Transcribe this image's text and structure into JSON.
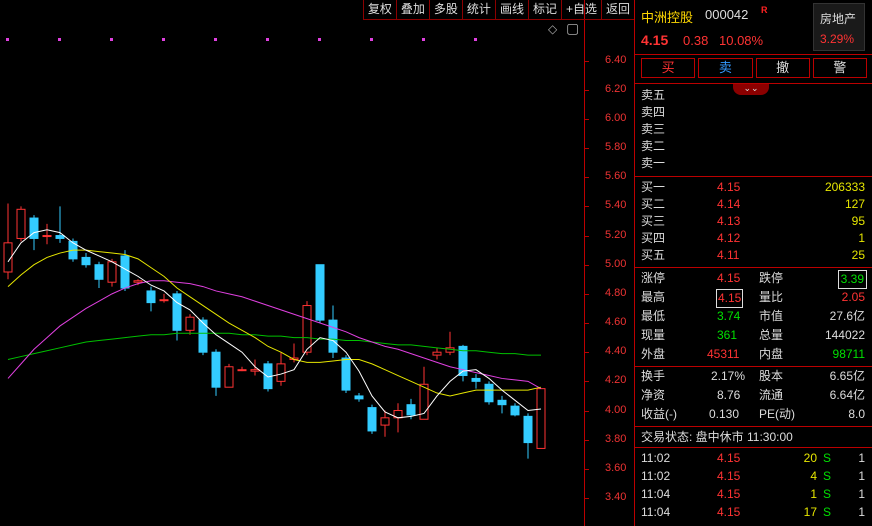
{
  "toolbar": [
    "复权",
    "叠加",
    "多股",
    "统计",
    "画线",
    "标记",
    "+自选",
    "返回"
  ],
  "chart_glyphs": {
    "diamond": "◇",
    "window": "▢"
  },
  "price_axis": [
    "6.40",
    "6.20",
    "6.00",
    "5.80",
    "5.60",
    "5.40",
    "5.20",
    "5.00",
    "4.80",
    "4.60",
    "4.40",
    "4.20",
    "4.00",
    "3.80",
    "3.60",
    "3.40"
  ],
  "chart_data": {
    "type": "candlestick",
    "ylim": [
      3.4,
      6.5
    ],
    "colors": {
      "up": "#ff3333",
      "down": "#33ccff",
      "ma5": "#ffffff",
      "ma10": "#e6e600",
      "ma20": "#e040e0",
      "ma60": "#00c000"
    },
    "candles": [
      {
        "o": 4.95,
        "h": 5.42,
        "l": 4.9,
        "c": 5.15
      },
      {
        "o": 5.18,
        "h": 5.4,
        "l": 5.16,
        "c": 5.38
      },
      {
        "o": 5.32,
        "h": 5.34,
        "l": 5.1,
        "c": 5.18
      },
      {
        "o": 5.2,
        "h": 5.28,
        "l": 5.14,
        "c": 5.2
      },
      {
        "o": 5.2,
        "h": 5.4,
        "l": 5.15,
        "c": 5.18
      },
      {
        "o": 5.16,
        "h": 5.18,
        "l": 5.02,
        "c": 5.04
      },
      {
        "o": 5.05,
        "h": 5.08,
        "l": 4.98,
        "c": 5.0
      },
      {
        "o": 5.0,
        "h": 5.02,
        "l": 4.84,
        "c": 4.9
      },
      {
        "o": 4.88,
        "h": 5.04,
        "l": 4.85,
        "c": 5.02
      },
      {
        "o": 5.06,
        "h": 5.1,
        "l": 4.82,
        "c": 4.84
      },
      {
        "o": 4.88,
        "h": 4.9,
        "l": 4.86,
        "c": 4.89
      },
      {
        "o": 4.82,
        "h": 4.85,
        "l": 4.68,
        "c": 4.74
      },
      {
        "o": 4.76,
        "h": 4.8,
        "l": 4.74,
        "c": 4.76
      },
      {
        "o": 4.8,
        "h": 4.82,
        "l": 4.48,
        "c": 4.55
      },
      {
        "o": 4.55,
        "h": 4.66,
        "l": 4.52,
        "c": 4.64
      },
      {
        "o": 4.62,
        "h": 4.64,
        "l": 4.38,
        "c": 4.4
      },
      {
        "o": 4.4,
        "h": 4.42,
        "l": 4.1,
        "c": 4.16
      },
      {
        "o": 4.16,
        "h": 4.32,
        "l": 4.16,
        "c": 4.3
      },
      {
        "o": 4.28,
        "h": 4.3,
        "l": 4.27,
        "c": 4.28
      },
      {
        "o": 4.27,
        "h": 4.35,
        "l": 4.24,
        "c": 4.28
      },
      {
        "o": 4.32,
        "h": 4.34,
        "l": 4.13,
        "c": 4.15
      },
      {
        "o": 4.2,
        "h": 4.4,
        "l": 4.17,
        "c": 4.32
      },
      {
        "o": 4.35,
        "h": 4.46,
        "l": 4.33,
        "c": 4.36
      },
      {
        "o": 4.4,
        "h": 4.75,
        "l": 4.38,
        "c": 4.72
      },
      {
        "o": 5.0,
        "h": 5.0,
        "l": 4.6,
        "c": 4.62
      },
      {
        "o": 4.62,
        "h": 4.72,
        "l": 4.36,
        "c": 4.4
      },
      {
        "o": 4.36,
        "h": 4.38,
        "l": 4.12,
        "c": 4.14
      },
      {
        "o": 4.1,
        "h": 4.12,
        "l": 4.06,
        "c": 4.08
      },
      {
        "o": 4.02,
        "h": 4.04,
        "l": 3.84,
        "c": 3.86
      },
      {
        "o": 3.9,
        "h": 4.0,
        "l": 3.82,
        "c": 3.95
      },
      {
        "o": 3.95,
        "h": 4.05,
        "l": 3.85,
        "c": 4.0
      },
      {
        "o": 4.04,
        "h": 4.08,
        "l": 3.94,
        "c": 3.97
      },
      {
        "o": 3.94,
        "h": 4.3,
        "l": 3.94,
        "c": 4.18
      },
      {
        "o": 4.38,
        "h": 4.43,
        "l": 4.35,
        "c": 4.4
      },
      {
        "o": 4.4,
        "h": 4.54,
        "l": 4.38,
        "c": 4.43
      },
      {
        "o": 4.44,
        "h": 4.45,
        "l": 4.2,
        "c": 4.24
      },
      {
        "o": 4.22,
        "h": 4.25,
        "l": 4.15,
        "c": 4.2
      },
      {
        "o": 4.18,
        "h": 4.2,
        "l": 4.04,
        "c": 4.06
      },
      {
        "o": 4.07,
        "h": 4.1,
        "l": 3.98,
        "c": 4.04
      },
      {
        "o": 4.03,
        "h": 4.05,
        "l": 3.96,
        "c": 3.97
      },
      {
        "o": 3.96,
        "h": 3.98,
        "l": 3.67,
        "c": 3.78
      },
      {
        "o": 3.74,
        "h": 4.15,
        "l": 3.74,
        "c": 4.15
      }
    ],
    "ma5": [
      5.02,
      5.15,
      5.22,
      5.24,
      5.22,
      5.15,
      5.1,
      5.06,
      5.02,
      4.97,
      4.92,
      4.86,
      4.82,
      4.74,
      4.69,
      4.6,
      4.52,
      4.46,
      4.4,
      4.3,
      4.23,
      4.25,
      4.28,
      4.42,
      4.5,
      4.48,
      4.4,
      4.27,
      4.1,
      3.99,
      3.95,
      3.96,
      3.98,
      4.1,
      4.2,
      4.27,
      4.28,
      4.22,
      4.14,
      4.07,
      4.0,
      4.01
    ],
    "ma10": [
      4.85,
      4.93,
      5.0,
      5.05,
      5.08,
      5.1,
      5.1,
      5.09,
      5.08,
      5.07,
      5.04,
      4.98,
      4.92,
      4.84,
      4.78,
      4.72,
      4.66,
      4.6,
      4.55,
      4.5,
      4.44,
      4.4,
      4.35,
      4.33,
      4.33,
      4.34,
      4.35,
      4.35,
      4.32,
      4.28,
      4.24,
      4.2,
      4.16,
      4.12,
      4.1,
      4.12,
      4.14,
      4.14,
      4.14,
      4.14,
      4.14,
      4.16
    ],
    "ma20": [
      4.22,
      4.32,
      4.42,
      4.5,
      4.58,
      4.64,
      4.7,
      4.75,
      4.8,
      4.84,
      4.87,
      4.89,
      4.89,
      4.88,
      4.87,
      4.85,
      4.82,
      4.8,
      4.78,
      4.75,
      4.72,
      4.69,
      4.66,
      4.63,
      4.6,
      4.57,
      4.54,
      4.5,
      4.47,
      4.44,
      4.42,
      4.39,
      4.36,
      4.33,
      4.3,
      4.28,
      4.26,
      4.24,
      4.22,
      4.21,
      4.2,
      4.15
    ],
    "ma60": [
      4.35,
      4.37,
      4.39,
      4.41,
      4.43,
      4.45,
      4.47,
      4.48,
      4.49,
      4.5,
      4.51,
      4.52,
      4.52,
      4.53,
      4.53,
      4.53,
      4.53,
      4.53,
      4.52,
      4.52,
      4.51,
      4.51,
      4.5,
      4.5,
      4.49,
      4.49,
      4.48,
      4.48,
      4.47,
      4.46,
      4.45,
      4.45,
      4.44,
      4.43,
      4.42,
      4.41,
      4.41,
      4.4,
      4.39,
      4.39,
      4.38,
      4.38
    ]
  },
  "quote": {
    "name": "中洲控股",
    "code": "000042",
    "r_mark": "R",
    "price": "4.15",
    "change": "0.38",
    "change_pct": "10.08%",
    "sector": "房地产",
    "sector_pct": "3.29%"
  },
  "actions": [
    "买",
    "卖",
    "撤",
    "警"
  ],
  "collapse_glyph": "⌄⌄",
  "sell_orders": [
    {
      "label": "卖五",
      "price": "",
      "vol": ""
    },
    {
      "label": "卖四",
      "price": "",
      "vol": ""
    },
    {
      "label": "卖三",
      "price": "",
      "vol": ""
    },
    {
      "label": "卖二",
      "price": "",
      "vol": ""
    },
    {
      "label": "卖一",
      "price": "",
      "vol": ""
    }
  ],
  "buy_orders": [
    {
      "label": "买一",
      "price": "4.15",
      "vol": "206333"
    },
    {
      "label": "买二",
      "price": "4.14",
      "vol": "127"
    },
    {
      "label": "买三",
      "price": "4.13",
      "vol": "95"
    },
    {
      "label": "买四",
      "price": "4.12",
      "vol": "1"
    },
    {
      "label": "买五",
      "price": "4.11",
      "vol": "25"
    }
  ],
  "stats": {
    "limit_up_label": "涨停",
    "limit_up": "4.15",
    "limit_down_label": "跌停",
    "limit_down": "3.39",
    "high_label": "最高",
    "high": "4.15",
    "vol_ratio_label": "量比",
    "vol_ratio": "2.05",
    "low_label": "最低",
    "low": "3.74",
    "market_cap_label": "市值",
    "market_cap": "27.6亿",
    "last_vol_label": "现量",
    "last_vol": "361",
    "total_vol_label": "总量",
    "total_vol": "144022",
    "outer_label": "外盘",
    "outer": "45311",
    "inner_label": "内盘",
    "inner": "98711"
  },
  "fundamentals": {
    "turnover_label": "换手",
    "turnover": "2.17%",
    "share_cap_label": "股本",
    "share_cap": "6.65亿",
    "nav_label": "净资",
    "nav": "8.76",
    "float_label": "流通",
    "float": "6.64亿",
    "eps_label": "收益(-)",
    "eps": "0.130",
    "pe_label": "PE(动)",
    "pe": "8.0"
  },
  "status": "交易状态: 盘中休市 11:30:00",
  "trades": [
    {
      "time": "11:02",
      "price": "4.15",
      "vol": "20",
      "side": "S",
      "n": "1"
    },
    {
      "time": "11:02",
      "price": "4.15",
      "vol": "4",
      "side": "S",
      "n": "1"
    },
    {
      "time": "11:04",
      "price": "4.15",
      "vol": "1",
      "side": "S",
      "n": "1"
    },
    {
      "time": "11:04",
      "price": "4.15",
      "vol": "17",
      "side": "S",
      "n": "1"
    }
  ]
}
